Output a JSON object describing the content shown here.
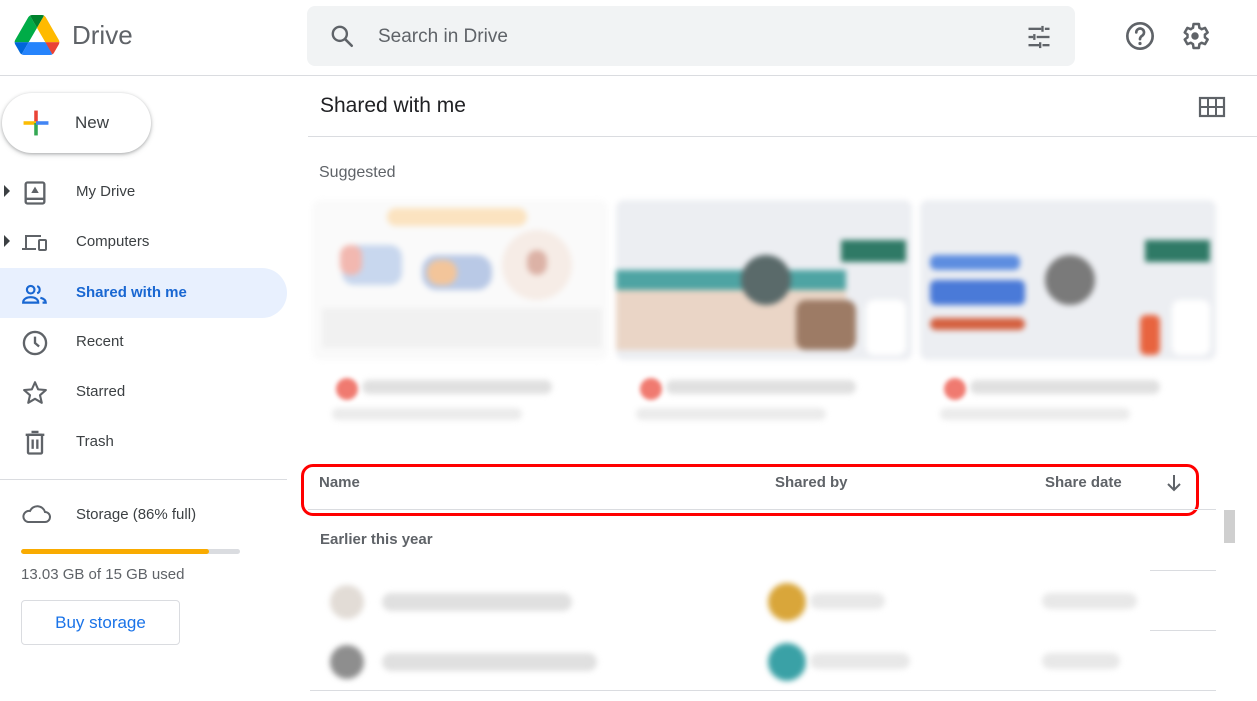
{
  "header": {
    "brand": "Drive",
    "search_placeholder": "Search in Drive",
    "icons": [
      "drive-logo",
      "search-icon",
      "tune-icon",
      "help-icon",
      "settings-icon"
    ]
  },
  "sidebar": {
    "new_label": "New",
    "items": [
      {
        "label": "My Drive",
        "icon": "my-drive-icon",
        "expandable": true,
        "active": false
      },
      {
        "label": "Computers",
        "icon": "computers-icon",
        "expandable": true,
        "active": false
      },
      {
        "label": "Shared with me",
        "icon": "people-icon",
        "expandable": false,
        "active": true
      },
      {
        "label": "Recent",
        "icon": "clock-icon",
        "expandable": false,
        "active": false
      },
      {
        "label": "Starred",
        "icon": "star-icon",
        "expandable": false,
        "active": false
      },
      {
        "label": "Trash",
        "icon": "trash-icon",
        "expandable": false,
        "active": false
      }
    ],
    "storage": {
      "label": "Storage (86% full)",
      "percent_used": 86,
      "used_text": "13.03 GB of 15 GB used",
      "bar_color": "#f9ab00",
      "buy_label": "Buy storage"
    }
  },
  "main": {
    "title": "Shared with me",
    "view_toggle_icon": "grid-view-icon",
    "suggested_label": "Suggested",
    "suggested_count": 3,
    "table": {
      "columns": [
        "Name",
        "Shared by",
        "Share date"
      ],
      "sort_icon": "arrow-down-icon",
      "groups": [
        {
          "label": "Earlier this year",
          "row_count": 2
        }
      ]
    }
  },
  "colors": {
    "accent": "#1a73e8",
    "active_nav_bg": "#e8f0fe",
    "active_nav_text": "#1967d2",
    "highlight": "#ff0000"
  }
}
